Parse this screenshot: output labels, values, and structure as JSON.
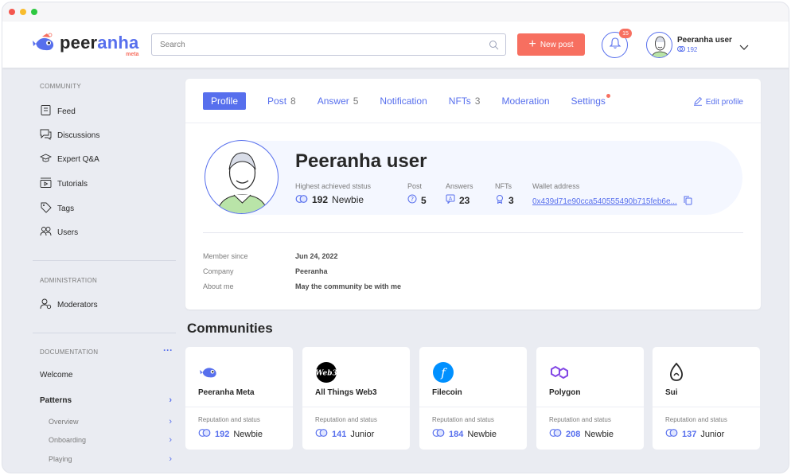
{
  "header": {
    "logo_text_a": "peer",
    "logo_text_b": "anha",
    "logo_sub": "meta",
    "search_placeholder": "Search",
    "new_post_label": "New post",
    "notifications_count": "15",
    "user_name": "Peeranha user",
    "user_rating": "192"
  },
  "sidebar": {
    "community_title": "COMMUNITY",
    "community_items": [
      {
        "label": "Feed",
        "icon": "feed-icon"
      },
      {
        "label": "Discussions",
        "icon": "discussions-icon"
      },
      {
        "label": "Expert Q&A",
        "icon": "expert-icon"
      },
      {
        "label": "Tutorials",
        "icon": "tutorials-icon"
      },
      {
        "label": "Tags",
        "icon": "tag-icon"
      },
      {
        "label": "Users",
        "icon": "users-icon"
      }
    ],
    "admin_title": "ADMINISTRATION",
    "admin_items": [
      {
        "label": "Moderators",
        "icon": "moderators-icon"
      }
    ],
    "docs_title": "DOCUMENTATION",
    "docs_items": [
      {
        "label": "Welcome"
      },
      {
        "label": "Patterns"
      }
    ],
    "docs_sub_items": [
      {
        "label": "Overview"
      },
      {
        "label": "Onboarding"
      },
      {
        "label": "Playing"
      }
    ]
  },
  "profile": {
    "tabs": [
      {
        "label": "Profile",
        "count": ""
      },
      {
        "label": "Post",
        "count": "8"
      },
      {
        "label": "Answer",
        "count": "5"
      },
      {
        "label": "Notification",
        "count": ""
      },
      {
        "label": "NFTs",
        "count": "3"
      },
      {
        "label": "Moderation",
        "count": ""
      },
      {
        "label": "Settings",
        "count": ""
      }
    ],
    "edit_label": "Edit profile",
    "name": "Peeranha user",
    "status_label": "Highest achieved ststus",
    "status_rating": "192",
    "status_name": "Newbie",
    "post_label": "Post",
    "post_value": "5",
    "answers_label": "Answers",
    "answers_value": "23",
    "nfts_label": "NFTs",
    "nfts_value": "3",
    "wallet_label": "Wallet address",
    "wallet_value": "0x439d71e90cca540555490b715feb6e...",
    "member_since_label": "Member since",
    "member_since_value": "Jun 24, 2022",
    "company_label": "Company",
    "company_value": "Peeranha",
    "about_label": "About me",
    "about_value": "May the community be with me"
  },
  "communities": {
    "title": "Communities",
    "rep_label": "Reputation and status",
    "items": [
      {
        "name": "Peeranha Meta",
        "rating": "192",
        "status": "Newbie",
        "icon": "peeranha-icon",
        "color": "#576fed"
      },
      {
        "name": "All Things Web3",
        "rating": "141",
        "status": "Junior",
        "icon": "web3-icon",
        "color": "#000000"
      },
      {
        "name": "Filecoin",
        "rating": "184",
        "status": "Newbie",
        "icon": "filecoin-icon",
        "color": "#0090ff"
      },
      {
        "name": "Polygon",
        "rating": "208",
        "status": "Newbie",
        "icon": "polygon-icon",
        "color": "#8247e5"
      },
      {
        "name": "Sui",
        "rating": "137",
        "status": "Junior",
        "icon": "sui-icon",
        "color": "#282828"
      }
    ]
  },
  "colors": {
    "accent": "#576fed",
    "brand_red": "#f76f60"
  }
}
